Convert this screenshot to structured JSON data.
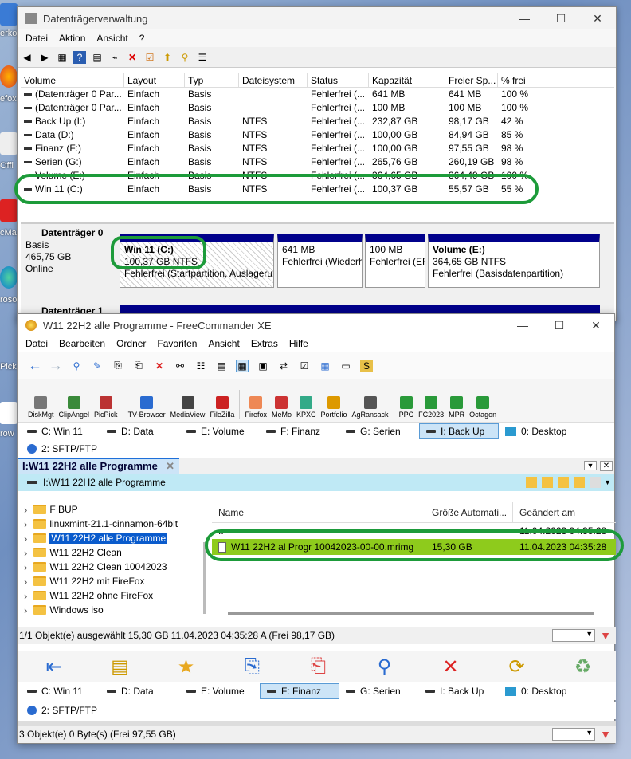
{
  "desktop": {
    "icons": [
      "erko",
      "efox",
      "Offi\n75",
      "cMa",
      "roso\nedge",
      "Pick",
      "row"
    ]
  },
  "dm": {
    "title": "Datenträgerverwaltung",
    "menu": [
      "Datei",
      "Aktion",
      "Ansicht",
      "?"
    ],
    "columns": [
      "Volume",
      "Layout",
      "Typ",
      "Dateisystem",
      "Status",
      "Kapazität",
      "Freier Sp...",
      "% frei"
    ],
    "rows": [
      [
        "(Datenträger 0 Par...",
        "Einfach",
        "Basis",
        "",
        "Fehlerfrei (...",
        "641 MB",
        "641 MB",
        "100 %"
      ],
      [
        "(Datenträger 0 Par...",
        "Einfach",
        "Basis",
        "",
        "Fehlerfrei (...",
        "100 MB",
        "100 MB",
        "100 %"
      ],
      [
        "Back Up (I:)",
        "Einfach",
        "Basis",
        "NTFS",
        "Fehlerfrei (...",
        "232,87 GB",
        "98,17 GB",
        "42 %"
      ],
      [
        "Data (D:)",
        "Einfach",
        "Basis",
        "NTFS",
        "Fehlerfrei (...",
        "100,00 GB",
        "84,94 GB",
        "85 %"
      ],
      [
        "Finanz (F:)",
        "Einfach",
        "Basis",
        "NTFS",
        "Fehlerfrei (...",
        "100,00 GB",
        "97,55 GB",
        "98 %"
      ],
      [
        "Serien (G:)",
        "Einfach",
        "Basis",
        "NTFS",
        "Fehlerfrei (...",
        "265,76 GB",
        "260,19 GB",
        "98 %"
      ],
      [
        "Volume (E:)",
        "Einfach",
        "Basis",
        "NTFS",
        "Fehlerfrei (...",
        "364,65 GB",
        "364,49 GB",
        "100 %"
      ],
      [
        "Win 11 (C:)",
        "Einfach",
        "Basis",
        "NTFS",
        "Fehlerfrei (...",
        "100,37 GB",
        "55,57 GB",
        "55 %"
      ]
    ],
    "disk0": {
      "name": "Datenträger 0",
      "type": "Basis",
      "size": "465,75 GB",
      "state": "Online"
    },
    "disk1": {
      "name": "Datenträger 1"
    },
    "parts": [
      {
        "l1": "Win 11  (C:)",
        "l2": "100,37 GB NTFS",
        "l3": "Fehlerfrei (Startpartition, Auslagerungsdatei"
      },
      {
        "l1": "",
        "l2": "641 MB",
        "l3": "Fehlerfrei (Wiederherstellungspartition)"
      },
      {
        "l1": "",
        "l2": "100 MB",
        "l3": "Fehlerfrei (EFI-Systempartition)"
      },
      {
        "l1": "Volume  (E:)",
        "l2": "364,65 GB NTFS",
        "l3": "Fehlerfrei (Basisdatenpartition)"
      }
    ]
  },
  "fc": {
    "title": "W11 22H2 alle Programme - FreeCommander XE",
    "menu": [
      "Datei",
      "Bearbeiten",
      "Ordner",
      "Favoriten",
      "Ansicht",
      "Extras",
      "Hilfe"
    ],
    "tools": [
      "DiskMgt",
      "ClipAngel",
      "PicPick",
      "TV-Browser",
      "MediaView",
      "FileZilla",
      "Firefox",
      "MeMo",
      "KPXC",
      "Portfolio",
      "AgRansack",
      "PPC",
      "FC2023",
      "MPR",
      "Octagon"
    ],
    "drives_top": [
      "C: Win 11",
      "D: Data",
      "E: Volume",
      "F: Finanz",
      "G: Serien",
      "I: Back Up",
      "0: Desktop"
    ],
    "sftp": "2: SFTP/FTP",
    "tab": "I:W11 22H2 alle Programme",
    "path": "I:\\W11 22H2 alle Programme",
    "tree": [
      "F BUP",
      "linuxmint-21.1-cinnamon-64bit",
      "W11 22H2 alle Programme",
      "W11 22H2 Clean",
      "W11 22H2 Clean 10042023",
      "W11 22H2 mit FireFox",
      "W11 22H2 ohne FireFox",
      "Windows iso"
    ],
    "fcols": [
      "Name",
      "Größe Automati...",
      "Geändert am"
    ],
    "files": [
      {
        "name": "..",
        "size": "",
        "date": "11.04.2023 04:35:28"
      },
      {
        "name": "W11 22H2 al Progr 10042023-00-00.mrimg",
        "size": "15,30 GB",
        "date": "11.04.2023 04:35:28"
      }
    ],
    "status1": "1/1 Objekt(e) ausgewählt  15,30 GB  11.04.2023 04:35:28  A  (Frei 98,17 GB)",
    "drives_bottom": [
      "C: Win 11",
      "D: Data",
      "E: Volume",
      "F: Finanz",
      "G: Serien",
      "I: Back Up",
      "0: Desktop"
    ],
    "status2": "3 Objekt(e)  0 Byte(s)  (Frei 97,55 GB)"
  }
}
